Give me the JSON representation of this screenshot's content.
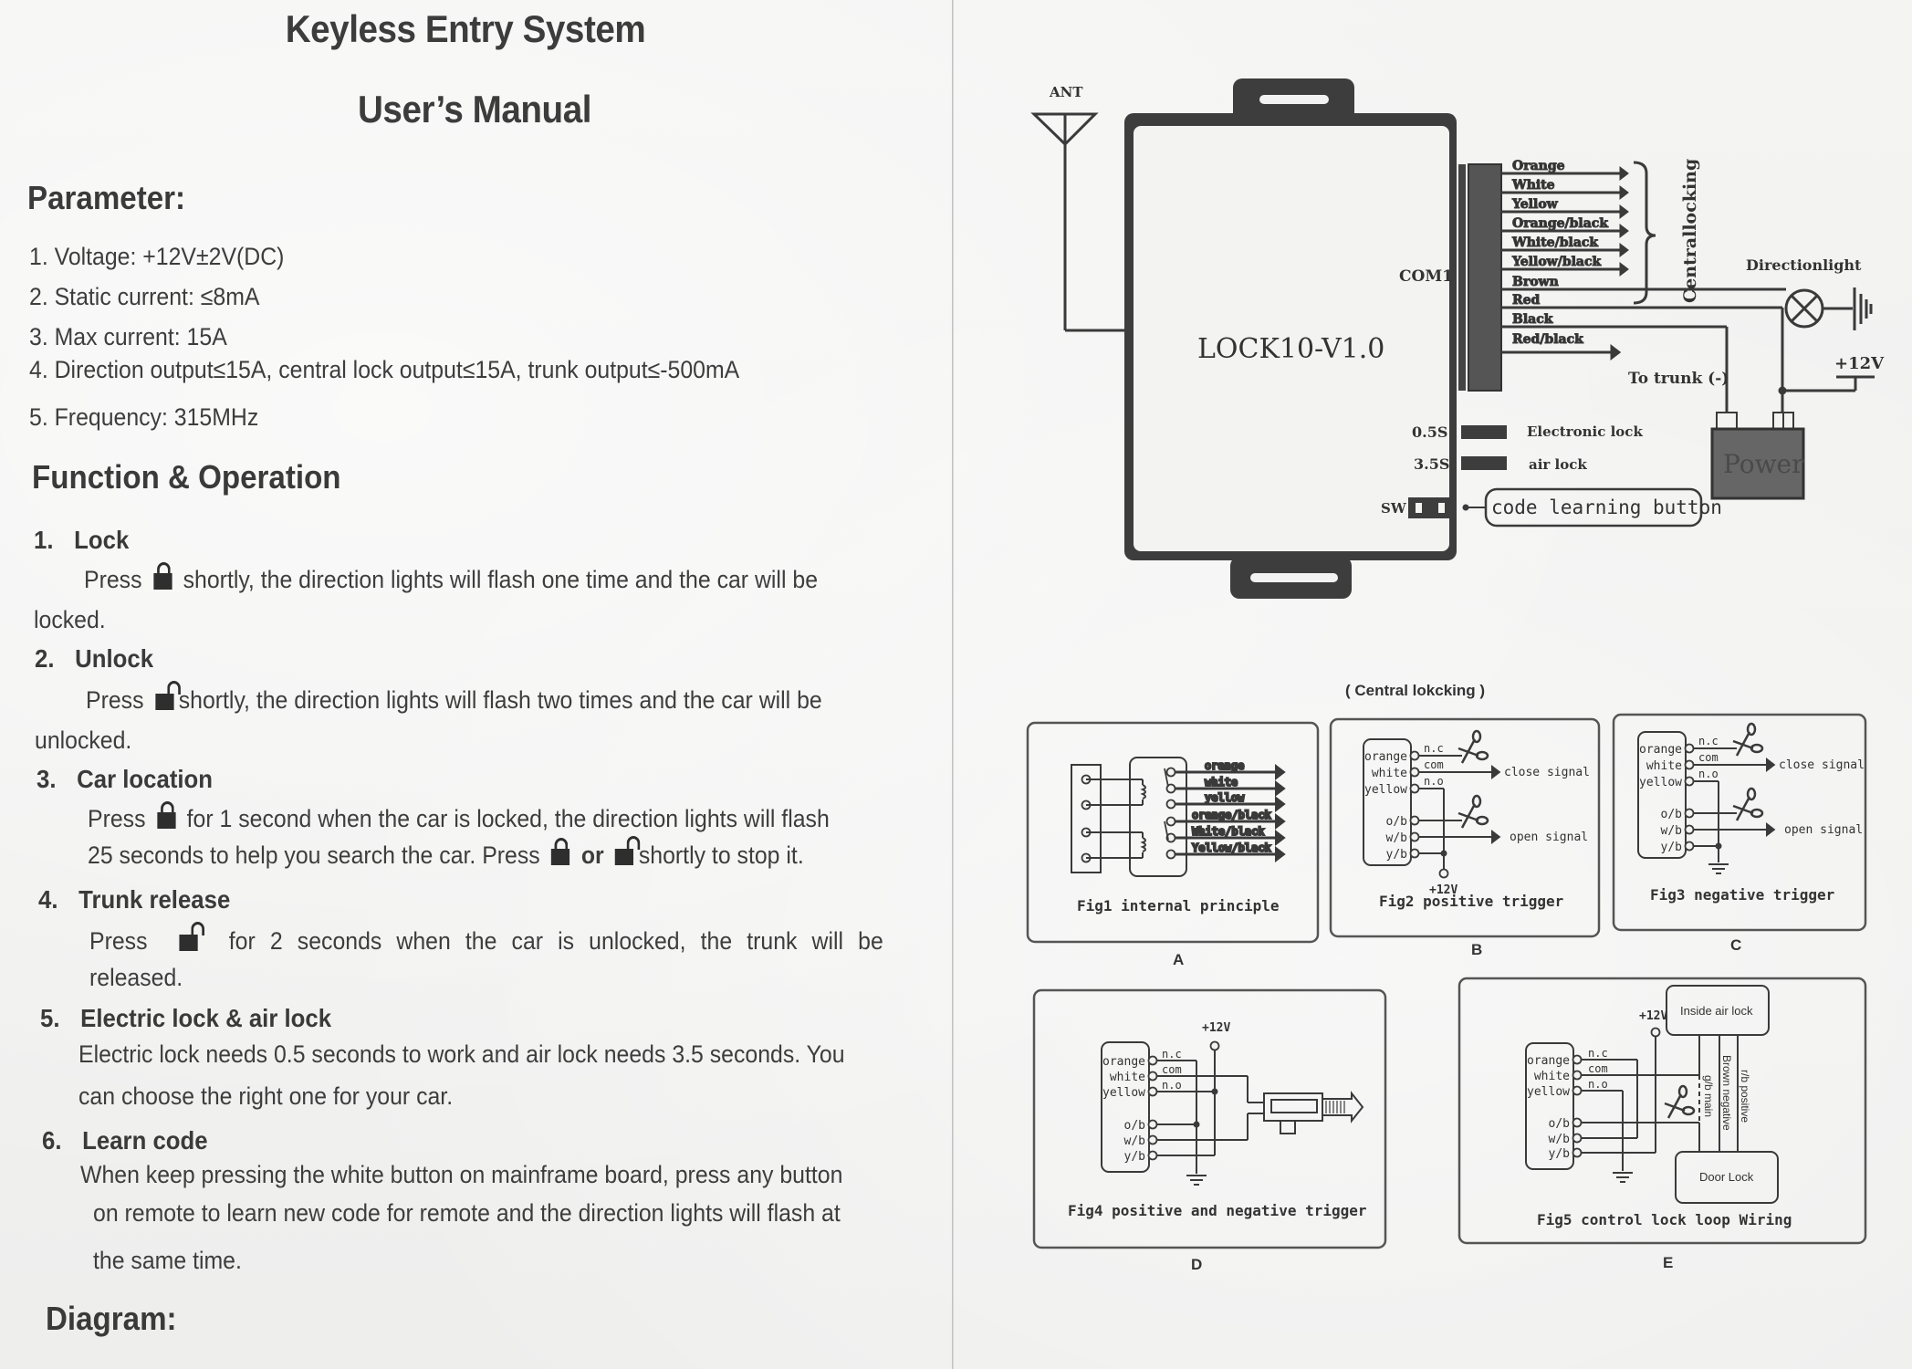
{
  "document": {
    "title": "Keyless Entry System",
    "subtitle": "User’s Manual",
    "paper_color": "#f3f3f2",
    "ink_color": "#3a3a3a"
  },
  "parameters": {
    "heading": "Parameter:",
    "items": [
      "1. Voltage: +12V±2V(DC)",
      "2. Static current: ≤8mA",
      "3. Max current: 15A",
      "4. Direction output≤15A, central lock output≤15A, trunk output≤-500mA",
      "5. Frequency: 315MHz"
    ]
  },
  "functions": {
    "heading": "Function & Operation",
    "sections": [
      {
        "num": "1.",
        "title": "Lock",
        "line1_pre": "Press",
        "line1_icon": "lock-icon",
        "line1_post": "shortly, the direction lights will flash one time and the car will be",
        "line2": "locked."
      },
      {
        "num": "2.",
        "title": "Unlock",
        "line1_pre": "Press",
        "line1_icon": "unlock-icon",
        "line1_post": "shortly, the direction lights will flash two times and the car will be",
        "line2": "unlocked."
      },
      {
        "num": "3.",
        "title": "Car location",
        "line1_pre": "Press",
        "line1_icon": "lock-icon",
        "line1_post": "for 1 second when the car is locked, the direction lights will flash",
        "line2_pre": "25 seconds to help you search the car. Press",
        "line2_or": "or",
        "line2_post": "shortly to stop it."
      },
      {
        "num": "4.",
        "title": "Trunk release",
        "line1_pre": "Press",
        "line1_icon": "unlock-icon",
        "line1_post": "for 2 seconds when the car is unlocked, the trunk will be",
        "line2": "released."
      },
      {
        "num": "5.",
        "title": "Electric lock & air lock",
        "line1": "Electric lock needs 0.5 seconds to work and air lock needs 3.5 seconds. You",
        "line2": "can choose the right one for your car."
      },
      {
        "num": "6.",
        "title": "Learn code",
        "line1": "When keep pressing the white button on mainframe board, press any button",
        "line2": "on remote to learn new code for remote and the direction lights will flash at",
        "line3": "the same time."
      }
    ]
  },
  "diagram_heading": "Diagram:",
  "main_diagram": {
    "antenna_label": "ANT",
    "module_label": "LOCK10-V1.0",
    "connector_label": "COM1",
    "wires": [
      "Orange",
      "White",
      "Yellow",
      "Orange/black",
      "White/black",
      "Yellow/black",
      "Brown",
      "Red",
      "Black",
      "Red/black"
    ],
    "central_locking_label": "Centrallocking",
    "direction_light_label": "Directionlight",
    "trunk_label": "To trunk (-)",
    "power_label": "Power",
    "plus12v_label": "+12V",
    "jumpers": [
      {
        "time": "0.5S",
        "label": "Electronic lock"
      },
      {
        "time": "3.5S",
        "label": "air lock"
      }
    ],
    "switch_label": "SW",
    "code_button_label": "code learning button"
  },
  "central_locking_caption": "( Central lokcking )",
  "figures": [
    {
      "letter": "A",
      "caption": "Fig1 internal principle",
      "wires": [
        "orange",
        "white",
        "yellow",
        "orange/black",
        "White/black",
        "Yellow/black"
      ]
    },
    {
      "letter": "B",
      "caption": "Fig2 positive trigger",
      "pins": [
        "orange",
        "white",
        "yellow",
        "o/b",
        "w/b",
        "y/b"
      ],
      "contacts": [
        "n.c",
        "com",
        "n.o"
      ],
      "close_signal": "close signal",
      "open_signal": "open signal",
      "supply": "+12V"
    },
    {
      "letter": "C",
      "caption": "Fig3 negative trigger",
      "pins": [
        "orange",
        "white",
        "yellow",
        "o/b",
        "w/b",
        "y/b"
      ],
      "contacts": [
        "n.c",
        "com",
        "n.o"
      ],
      "close_signal": "close signal",
      "open_signal": "open signal"
    },
    {
      "letter": "D",
      "caption": "Fig4 positive and negative trigger",
      "pins": [
        "orange",
        "white",
        "yellow",
        "o/b",
        "w/b",
        "y/b"
      ],
      "contacts": [
        "n.c",
        "com",
        "n.o"
      ],
      "supply": "+12V"
    },
    {
      "letter": "E",
      "caption": "Fig5 control lock loop Wiring",
      "pins": [
        "orange",
        "white",
        "yellow",
        "o/b",
        "w/b",
        "y/b"
      ],
      "contacts": [
        "n.c",
        "com",
        "n.o"
      ],
      "supply": "+12V",
      "top_box": "Inside air lock",
      "bottom_box": "Door Lock",
      "wire_labels": [
        "g/b main",
        "Brown negative",
        "r/b positive"
      ]
    }
  ]
}
